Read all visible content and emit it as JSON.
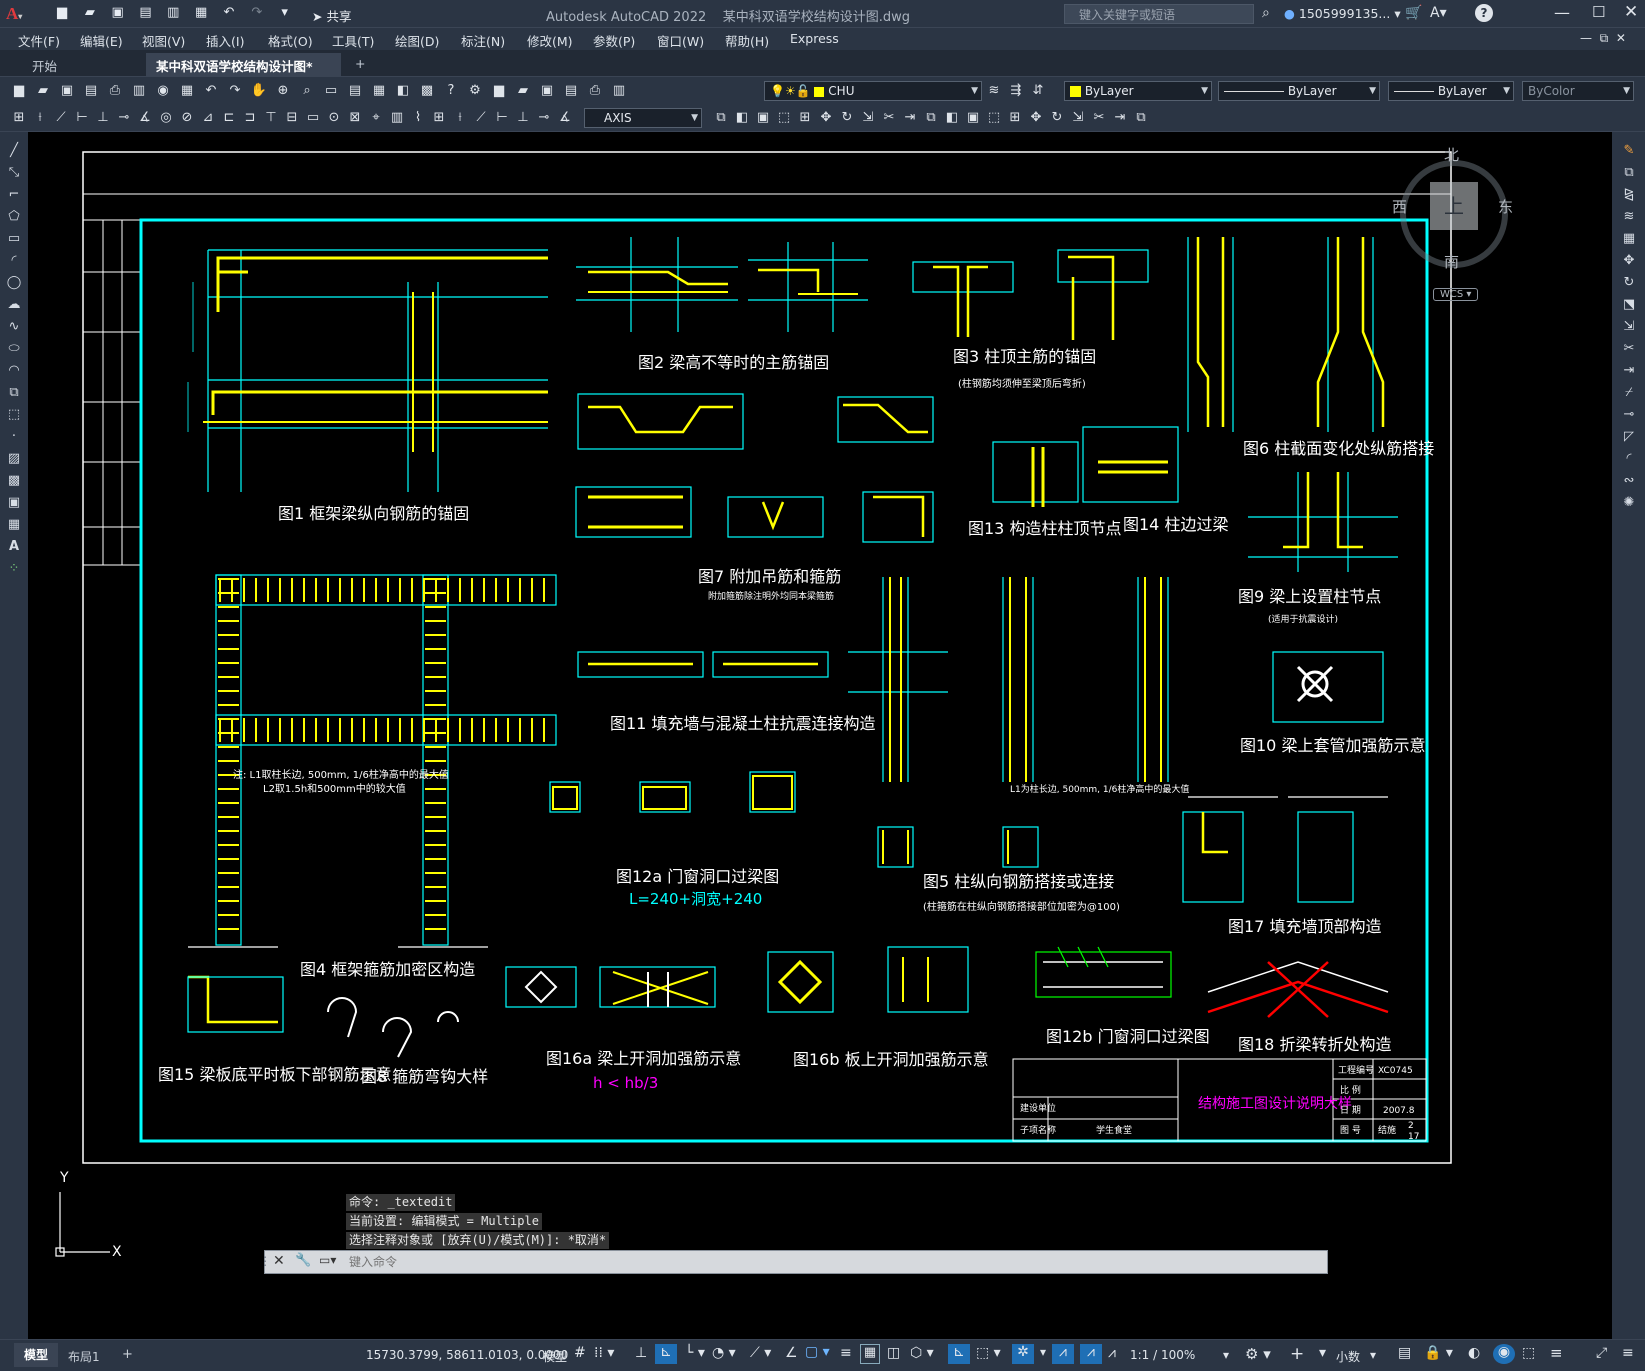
{
  "app": {
    "title": "Autodesk AutoCAD 2022",
    "file": "某中科双语学校结构设计图.dwg",
    "share_label": "共享",
    "search_placeholder": "键入关键字或短语",
    "user": "1505999135...",
    "accent": "#e03a3e"
  },
  "menu": [
    "文件(F)",
    "编辑(E)",
    "视图(V)",
    "插入(I)",
    "格式(O)",
    "工具(T)",
    "绘图(D)",
    "标注(N)",
    "修改(M)",
    "参数(P)",
    "窗口(W)",
    "帮助(H)",
    "Express"
  ],
  "tabs": {
    "start": "开始",
    "doc": "某中科双语学校结构设计图*",
    "add": "+"
  },
  "toolbar": {
    "layer": "CHU",
    "color": "ByLayer",
    "linetype": "ByLayer",
    "lineweight": "ByLayer",
    "plotstyle": "ByColor",
    "dimstyle": "AXIS"
  },
  "viewcube": {
    "north": "北",
    "south": "南",
    "east": "东",
    "west": "西",
    "top": "上",
    "wcs": "WCS"
  },
  "command": {
    "history": [
      "命令: _textedit",
      "当前设置: 编辑模式 = Multiple",
      "选择注释对象或 [放弃(U)/模式(M)]: *取消*"
    ],
    "placeholder": "键入命令"
  },
  "layout_tabs": {
    "model": "模型",
    "layout1": "布局1",
    "add": "+"
  },
  "status": {
    "coords": "15730.3799, 58611.0103, 0.0000",
    "model": "模型",
    "scale": "1:1 / 100%",
    "units": "小数"
  },
  "drawing": {
    "captions": {
      "f1": "图1 框架梁纵向钢筋的锚固",
      "f2": "图2 梁高不等时的主筋锚固",
      "f3": "图3 柱顶主筋的锚固",
      "f3_note": "(柱钢筋均须伸至梁顶后弯折)",
      "f4": "图4 框架箍筋加密区构造",
      "f5": "图5 柱纵向钢筋搭接或连接",
      "f5_note": "(柱箍筋在柱纵向钢筋搭接部位加密为@100)",
      "f6": "图6 柱截面变化处纵筋搭接",
      "f7": "图7 附加吊筋和箍筋",
      "f7_note": "附加箍筋除注明外均同本梁箍筋",
      "f8": "图8 箍筋弯钩大样",
      "f9": "图9 梁上设置柱节点",
      "f9_note": "(适用于抗震设计)",
      "f10": "图10 梁上套管加强筋示意",
      "f11": "图11 填充墙与混凝土柱抗震连接构造",
      "f12a": "图12a 门窗洞口过梁图",
      "f12a_formula": "L=240+洞宽+240",
      "f12b": "图12b 门窗洞口过梁图",
      "f13": "图13 构造柱柱顶节点",
      "f14": "图14 柱边过梁",
      "f15": "图15 梁板底平时板下部钢筋示意",
      "f16a": "图16a 梁上开洞加强筋示意",
      "f16a_cond": "h < hb/3",
      "f16b": "图16b 板上开洞加强筋示意",
      "f17": "图17 填充墙顶部构造",
      "f18": "图18 折梁转折处构造"
    },
    "notes": [
      "注: L1取柱长边, 500mm, 1/6柱净高中的最大值",
      "L2取1.5h和500mm中的较大值",
      "L1为柱长边, 500mm, 1/6柱净高中的最大值"
    ],
    "titleblock": {
      "title": "结构施工图设计说明大样",
      "project_no_label": "工程编号",
      "project_no": "XC0745",
      "scale_label": "比 例",
      "date_label": "日 期",
      "date": "2007.8",
      "sheet_label": "图 号",
      "sheet": "结施",
      "page": "2",
      "total": "17",
      "unit_label": "建设单位",
      "sub_label": "子项名称",
      "sub": "学生食堂"
    },
    "colors": {
      "frame": "#00ffff",
      "rebar": "#ffff00",
      "line": "#00ffff",
      "text": "#ffffff",
      "magenta": "#ff00ff",
      "red": "#ff0000",
      "green": "#00ff00"
    }
  }
}
